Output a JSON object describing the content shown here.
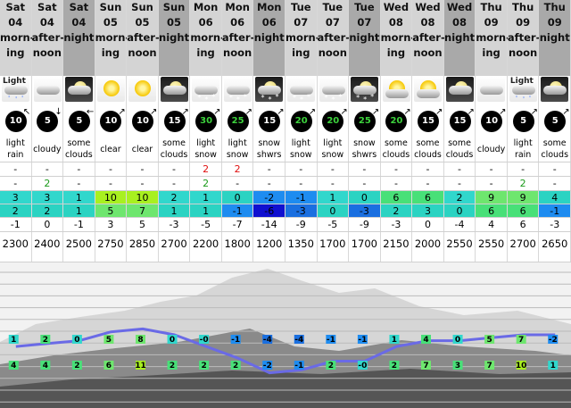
{
  "columns": [
    {
      "day": "Sat",
      "date": "04",
      "period": [
        "morn-",
        "ing"
      ],
      "sky": "cloud-rain",
      "icon_label": "Light",
      "wind": "10",
      "wind_dir": "arrow-nw",
      "desc": [
        "light",
        "rain"
      ],
      "rain": "-",
      "snow": "-",
      "max": "3",
      "min": "2",
      "feel": "-1",
      "freeze": "2300",
      "max_color": "#31d7cc",
      "min_color": "#2bd3c2"
    },
    {
      "day": "Sat",
      "date": "04",
      "period": [
        "after-",
        "noon"
      ],
      "sky": "cloud",
      "icon_label": "",
      "wind": "5",
      "wind_dir": "arrow-s",
      "desc": [
        "cloudy"
      ],
      "rain": "-",
      "snow": "2",
      "max": "3",
      "min": "2",
      "feel": "0",
      "freeze": "2400",
      "max_color": "#31d7cc",
      "min_color": "#2bd3c2"
    },
    {
      "day": "Sat",
      "date": "04",
      "period": [
        "night"
      ],
      "sky": "night-cloud",
      "icon_label": "",
      "wind": "5",
      "wind_dir": "arrow-w",
      "desc": [
        "some",
        "clouds"
      ],
      "rain": "-",
      "snow": "-",
      "max": "1",
      "min": "1",
      "feel": "-1",
      "freeze": "2500",
      "max_color": "#31d7cc",
      "min_color": "#2bd3c2"
    },
    {
      "day": "Sun",
      "date": "05",
      "period": [
        "morn-",
        "ing"
      ],
      "sky": "sun",
      "icon_label": "",
      "wind": "10",
      "wind_dir": "arrow-ne",
      "desc": [
        "clear"
      ],
      "rain": "-",
      "snow": "-",
      "max": "10",
      "min": "5",
      "feel": "3",
      "freeze": "2750",
      "max_color": "#a8f020",
      "min_color": "#6ee66e"
    },
    {
      "day": "Sun",
      "date": "05",
      "period": [
        "after-",
        "noon"
      ],
      "sky": "sun",
      "icon_label": "",
      "wind": "10",
      "wind_dir": "arrow-ne",
      "desc": [
        "clear"
      ],
      "rain": "-",
      "snow": "-",
      "max": "10",
      "min": "7",
      "feel": "5",
      "freeze": "2850",
      "max_color": "#a8f020",
      "min_color": "#6ee66e"
    },
    {
      "day": "Sun",
      "date": "05",
      "period": [
        "night"
      ],
      "sky": "night-cloud",
      "icon_label": "",
      "wind": "15",
      "wind_dir": "arrow-ne",
      "desc": [
        "some",
        "clouds"
      ],
      "rain": "-",
      "snow": "-",
      "max": "2",
      "min": "1",
      "feel": "-3",
      "freeze": "2700",
      "max_color": "#31d7cc",
      "min_color": "#2bd3c2"
    },
    {
      "day": "Mon",
      "date": "06",
      "period": [
        "morn-",
        "ing"
      ],
      "sky": "cloud-snow",
      "icon_label": "",
      "wind": "30",
      "wind_dir": "arrow-ne",
      "desc": [
        "light",
        "snow"
      ],
      "rain": "2",
      "snow": "2",
      "max": "1",
      "min": "1",
      "feel": "-5",
      "freeze": "2200",
      "max_color": "#31d7cc",
      "min_color": "#2bd3c2",
      "wind_green": true
    },
    {
      "day": "Mon",
      "date": "06",
      "period": [
        "after-",
        "noon"
      ],
      "sky": "cloud-snow",
      "icon_label": "",
      "wind": "25",
      "wind_dir": "arrow-ne",
      "desc": [
        "light",
        "snow"
      ],
      "rain": "2",
      "snow": "-",
      "max": "0",
      "min": "-1",
      "feel": "-7",
      "freeze": "1800",
      "max_color": "#2bd3c2",
      "min_color": "#1e8cf0",
      "wind_green": true
    },
    {
      "day": "Mon",
      "date": "06",
      "period": [
        "night"
      ],
      "sky": "night-snow",
      "icon_label": "",
      "wind": "15",
      "wind_dir": "arrow-ne",
      "desc": [
        "snow",
        "shwrs"
      ],
      "rain": "-",
      "snow": "-",
      "max": "-2",
      "min": "-6",
      "feel": "-14",
      "freeze": "1200",
      "max_color": "#1e8cf0",
      "min_color": "#1010d0"
    },
    {
      "day": "Tue",
      "date": "07",
      "period": [
        "morn-",
        "ing"
      ],
      "sky": "cloud-snow",
      "icon_label": "",
      "wind": "20",
      "wind_dir": "arrow-ne",
      "desc": [
        "light",
        "snow"
      ],
      "rain": "-",
      "snow": "-",
      "max": "-1",
      "min": "-3",
      "feel": "-9",
      "freeze": "1350",
      "max_color": "#1e8cf0",
      "min_color": "#1a6fe0",
      "wind_green": true
    },
    {
      "day": "Tue",
      "date": "07",
      "period": [
        "after-",
        "noon"
      ],
      "sky": "cloud-snow",
      "icon_label": "",
      "wind": "20",
      "wind_dir": "arrow-ne",
      "desc": [
        "light",
        "snow"
      ],
      "rain": "-",
      "snow": "-",
      "max": "1",
      "min": "0",
      "feel": "-5",
      "freeze": "1700",
      "max_color": "#31d7cc",
      "min_color": "#2bd3c2",
      "wind_green": true
    },
    {
      "day": "Tue",
      "date": "07",
      "period": [
        "night"
      ],
      "sky": "night-snow",
      "icon_label": "",
      "wind": "25",
      "wind_dir": "arrow-ne",
      "desc": [
        "snow",
        "shwrs"
      ],
      "rain": "-",
      "snow": "-",
      "max": "0",
      "min": "-3",
      "feel": "-9",
      "freeze": "1700",
      "max_color": "#2bd3c2",
      "min_color": "#1a6fe0",
      "wind_green": true
    },
    {
      "day": "Wed",
      "date": "08",
      "period": [
        "morn-",
        "ing"
      ],
      "sky": "sun-cloud",
      "icon_label": "",
      "wind": "20",
      "wind_dir": "arrow-ne",
      "desc": [
        "some",
        "clouds"
      ],
      "rain": "-",
      "snow": "-",
      "max": "6",
      "min": "2",
      "feel": "-3",
      "freeze": "2150",
      "max_color": "#48e078",
      "min_color": "#2bd3c2",
      "wind_green": true
    },
    {
      "day": "Wed",
      "date": "08",
      "period": [
        "after-",
        "noon"
      ],
      "sky": "sun-cloud",
      "icon_label": "",
      "wind": "15",
      "wind_dir": "arrow-ne",
      "desc": [
        "some",
        "clouds"
      ],
      "rain": "-",
      "snow": "-",
      "max": "6",
      "min": "3",
      "feel": "0",
      "freeze": "2000",
      "max_color": "#48e078",
      "min_color": "#2bd3c2"
    },
    {
      "day": "Wed",
      "date": "08",
      "period": [
        "night"
      ],
      "sky": "night-cloud",
      "icon_label": "",
      "wind": "15",
      "wind_dir": "arrow-ne",
      "desc": [
        "some",
        "clouds"
      ],
      "rain": "-",
      "snow": "-",
      "max": "2",
      "min": "0",
      "feel": "-4",
      "freeze": "2550",
      "max_color": "#31d7cc",
      "min_color": "#2bd3c2"
    },
    {
      "day": "Thu",
      "date": "09",
      "period": [
        "morn-",
        "ing"
      ],
      "sky": "cloud",
      "icon_label": "",
      "wind": "10",
      "wind_dir": "arrow-ne",
      "desc": [
        "cloudy"
      ],
      "rain": "-",
      "snow": "-",
      "max": "9",
      "min": "6",
      "feel": "4",
      "freeze": "2550",
      "max_color": "#6ee66e",
      "min_color": "#48e078"
    },
    {
      "day": "Thu",
      "date": "09",
      "period": [
        "after-",
        "noon"
      ],
      "sky": "cloud-rain",
      "icon_label": "Light",
      "wind": "5",
      "wind_dir": "arrow-ne",
      "desc": [
        "light",
        "rain"
      ],
      "rain": "-",
      "snow": "2",
      "max": "9",
      "min": "6",
      "feel": "6",
      "freeze": "2700",
      "max_color": "#6ee66e",
      "min_color": "#48e078"
    },
    {
      "day": "Thu",
      "date": "09",
      "period": [
        "night"
      ],
      "sky": "night-cloud",
      "icon_label": "",
      "wind": "5",
      "wind_dir": "arrow-ne",
      "desc": [
        "some",
        "clouds"
      ],
      "rain": "-",
      "snow": "-",
      "max": "4",
      "min": "-1",
      "feel": "-3",
      "freeze": "2650",
      "max_color": "#2bd3c2",
      "min_color": "#1e8cf0"
    }
  ],
  "chart_data": {
    "type": "line",
    "categories": [
      "Sat 04 morning",
      "Sat 04 afternoon",
      "Sat 04 night",
      "Sun 05 morning",
      "Sun 05 afternoon",
      "Sun 05 night",
      "Mon 06 morning",
      "Mon 06 afternoon",
      "Mon 06 night",
      "Tue 07 morning",
      "Tue 07 afternoon",
      "Tue 07 night",
      "Wed 08 morning",
      "Wed 08 afternoon",
      "Wed 08 night",
      "Thu 09 morning",
      "Thu 09 afternoon",
      "Thu 09 night"
    ],
    "series": [
      {
        "values": [
          1,
          2,
          0,
          5,
          8,
          0,
          0,
          -1,
          -4,
          -4,
          -1,
          -1,
          1,
          4,
          0,
          5,
          7,
          -2
        ]
      },
      {
        "values": [
          4,
          4,
          2,
          6,
          11,
          2,
          2,
          2,
          -2,
          -1,
          2,
          0,
          2,
          7,
          3,
          7,
          10,
          1
        ]
      }
    ],
    "line_values": [
      1,
      2,
      3,
      6,
      7,
      5,
      1,
      -3,
      -8,
      -7,
      -4,
      -4,
      1,
      3,
      3,
      4,
      5,
      5
    ],
    "ylim": [
      -20,
      30
    ],
    "line_color": "#6a6ae6"
  },
  "colors": {
    "header_a": "#d4d4d4",
    "header_b": "#a9a9a9",
    "rain": "#e01010",
    "snow": "#1a9a1a"
  }
}
